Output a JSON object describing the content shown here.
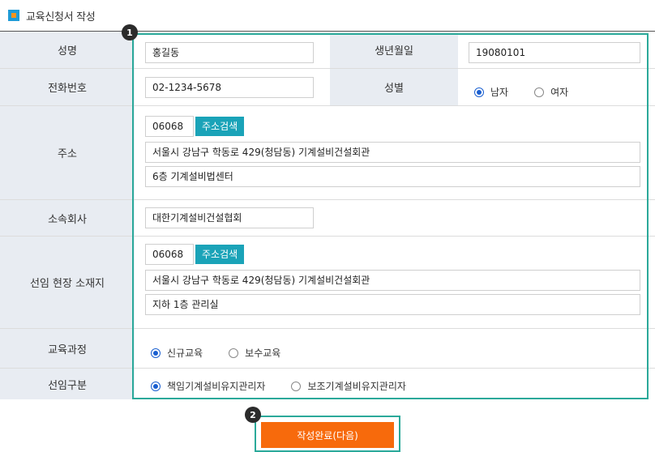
{
  "section": {
    "title": "교육신청서 작성"
  },
  "badges": {
    "one": "1",
    "two": "2"
  },
  "form": {
    "name": {
      "label": "성명",
      "value": "홍길동"
    },
    "birth": {
      "label": "생년월일",
      "value": "19080101"
    },
    "phone": {
      "label": "전화번호",
      "value": "02-1234-5678"
    },
    "gender": {
      "label": "성별",
      "options": [
        "남자",
        "여자"
      ],
      "selected": "남자"
    },
    "address": {
      "label": "주소",
      "zip": "06068",
      "search_label": "주소검색",
      "line1": "서울시 강남구 학동로 429(청담동) 기계설비건설회관",
      "line2": "6층 기계설비법센터"
    },
    "company": {
      "label": "소속회사",
      "value": "대한기계설비건설협회"
    },
    "site": {
      "label": "선임 현장 소재지",
      "zip": "06068",
      "search_label": "주소검색",
      "line1": "서울시 강남구 학동로 429(청담동) 기계설비건설회관",
      "line2": "지하 1층 관리실"
    },
    "course": {
      "label": "교육과정",
      "options": [
        "신규교육",
        "보수교육"
      ],
      "selected": "신규교육"
    },
    "appoint": {
      "label": "선임구분",
      "options": [
        "책임기계설비유지관리자",
        "보조기계설비유지관리자"
      ],
      "selected": "책임기계설비유지관리자"
    }
  },
  "submit": {
    "label": "작성완료(다음)"
  },
  "colors": {
    "highlight": "#2ba99a",
    "submit": "#f76a0c",
    "search_button": "#1aa3b8",
    "label_bg": "#e8ecf2"
  }
}
